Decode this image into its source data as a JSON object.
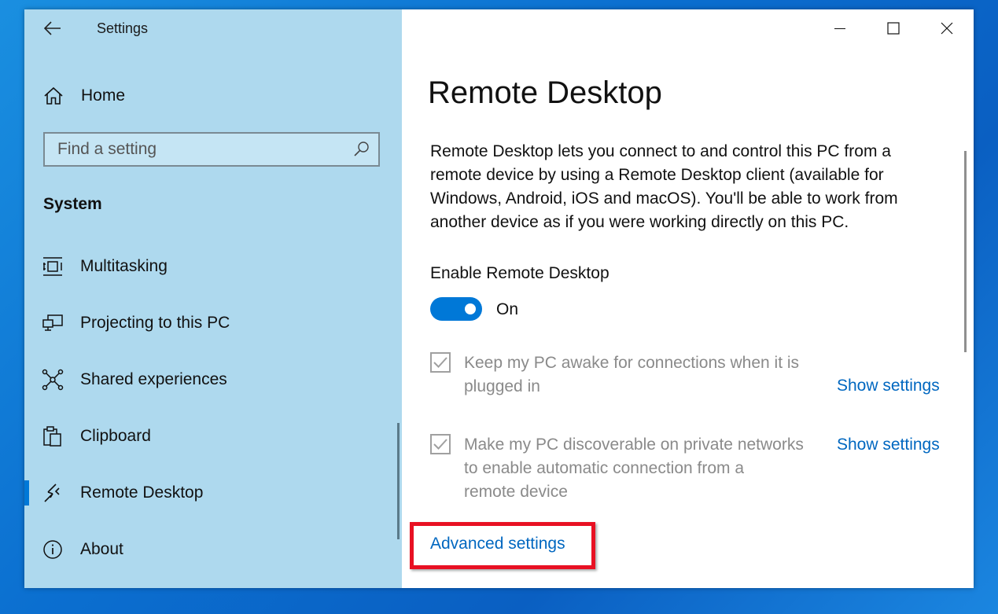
{
  "window": {
    "title": "Settings"
  },
  "sidebar": {
    "home_label": "Home",
    "search_placeholder": "Find a setting",
    "section_title": "System",
    "items": [
      {
        "label": "Multitasking",
        "icon": "multitasking-icon"
      },
      {
        "label": "Projecting to this PC",
        "icon": "projecting-icon"
      },
      {
        "label": "Shared experiences",
        "icon": "shared-experiences-icon"
      },
      {
        "label": "Clipboard",
        "icon": "clipboard-icon"
      },
      {
        "label": "Remote Desktop",
        "icon": "remote-desktop-icon",
        "selected": true
      },
      {
        "label": "About",
        "icon": "info-icon"
      }
    ]
  },
  "main": {
    "title": "Remote Desktop",
    "description": "Remote Desktop lets you connect to and control this PC from a remote device by using a Remote Desktop client (available for Windows, Android, iOS and macOS). You'll be able to work from another device as if you were working directly on this PC.",
    "toggle": {
      "label": "Enable Remote Desktop",
      "state": "On",
      "on": true
    },
    "options": [
      {
        "text_line1": "Keep my PC awake for connections when it is",
        "text_line2": "plugged in",
        "checked": true,
        "link": "Show settings"
      },
      {
        "text_line1": "Make my PC discoverable on private networks",
        "text_line2": "to enable automatic connection from a",
        "text_line3": "remote device",
        "checked": true,
        "link": "Show settings"
      }
    ],
    "advanced_link": "Advanced settings"
  },
  "colors": {
    "sidebar_bg": "#aed9ee",
    "accent": "#0078d7",
    "link": "#0067c0",
    "highlight": "#e81123"
  }
}
